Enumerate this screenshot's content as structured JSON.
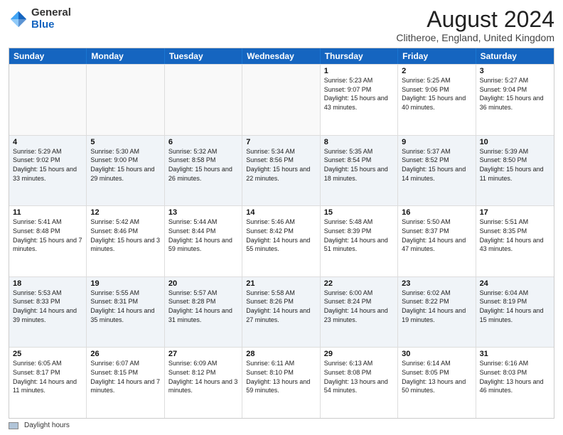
{
  "header": {
    "logo_general": "General",
    "logo_blue": "Blue",
    "main_title": "August 2024",
    "subtitle": "Clitheroe, England, United Kingdom"
  },
  "calendar": {
    "headers": [
      "Sunday",
      "Monday",
      "Tuesday",
      "Wednesday",
      "Thursday",
      "Friday",
      "Saturday"
    ],
    "rows": [
      [
        {
          "day": "",
          "sunrise": "",
          "sunset": "",
          "daylight": "",
          "empty": true
        },
        {
          "day": "",
          "sunrise": "",
          "sunset": "",
          "daylight": "",
          "empty": true
        },
        {
          "day": "",
          "sunrise": "",
          "sunset": "",
          "daylight": "",
          "empty": true
        },
        {
          "day": "",
          "sunrise": "",
          "sunset": "",
          "daylight": "",
          "empty": true
        },
        {
          "day": "1",
          "sunrise": "Sunrise: 5:23 AM",
          "sunset": "Sunset: 9:07 PM",
          "daylight": "Daylight: 15 hours and 43 minutes.",
          "empty": false
        },
        {
          "day": "2",
          "sunrise": "Sunrise: 5:25 AM",
          "sunset": "Sunset: 9:06 PM",
          "daylight": "Daylight: 15 hours and 40 minutes.",
          "empty": false
        },
        {
          "day": "3",
          "sunrise": "Sunrise: 5:27 AM",
          "sunset": "Sunset: 9:04 PM",
          "daylight": "Daylight: 15 hours and 36 minutes.",
          "empty": false
        }
      ],
      [
        {
          "day": "4",
          "sunrise": "Sunrise: 5:29 AM",
          "sunset": "Sunset: 9:02 PM",
          "daylight": "Daylight: 15 hours and 33 minutes.",
          "empty": false
        },
        {
          "day": "5",
          "sunrise": "Sunrise: 5:30 AM",
          "sunset": "Sunset: 9:00 PM",
          "daylight": "Daylight: 15 hours and 29 minutes.",
          "empty": false
        },
        {
          "day": "6",
          "sunrise": "Sunrise: 5:32 AM",
          "sunset": "Sunset: 8:58 PM",
          "daylight": "Daylight: 15 hours and 26 minutes.",
          "empty": false
        },
        {
          "day": "7",
          "sunrise": "Sunrise: 5:34 AM",
          "sunset": "Sunset: 8:56 PM",
          "daylight": "Daylight: 15 hours and 22 minutes.",
          "empty": false
        },
        {
          "day": "8",
          "sunrise": "Sunrise: 5:35 AM",
          "sunset": "Sunset: 8:54 PM",
          "daylight": "Daylight: 15 hours and 18 minutes.",
          "empty": false
        },
        {
          "day": "9",
          "sunrise": "Sunrise: 5:37 AM",
          "sunset": "Sunset: 8:52 PM",
          "daylight": "Daylight: 15 hours and 14 minutes.",
          "empty": false
        },
        {
          "day": "10",
          "sunrise": "Sunrise: 5:39 AM",
          "sunset": "Sunset: 8:50 PM",
          "daylight": "Daylight: 15 hours and 11 minutes.",
          "empty": false
        }
      ],
      [
        {
          "day": "11",
          "sunrise": "Sunrise: 5:41 AM",
          "sunset": "Sunset: 8:48 PM",
          "daylight": "Daylight: 15 hours and 7 minutes.",
          "empty": false
        },
        {
          "day": "12",
          "sunrise": "Sunrise: 5:42 AM",
          "sunset": "Sunset: 8:46 PM",
          "daylight": "Daylight: 15 hours and 3 minutes.",
          "empty": false
        },
        {
          "day": "13",
          "sunrise": "Sunrise: 5:44 AM",
          "sunset": "Sunset: 8:44 PM",
          "daylight": "Daylight: 14 hours and 59 minutes.",
          "empty": false
        },
        {
          "day": "14",
          "sunrise": "Sunrise: 5:46 AM",
          "sunset": "Sunset: 8:42 PM",
          "daylight": "Daylight: 14 hours and 55 minutes.",
          "empty": false
        },
        {
          "day": "15",
          "sunrise": "Sunrise: 5:48 AM",
          "sunset": "Sunset: 8:39 PM",
          "daylight": "Daylight: 14 hours and 51 minutes.",
          "empty": false
        },
        {
          "day": "16",
          "sunrise": "Sunrise: 5:50 AM",
          "sunset": "Sunset: 8:37 PM",
          "daylight": "Daylight: 14 hours and 47 minutes.",
          "empty": false
        },
        {
          "day": "17",
          "sunrise": "Sunrise: 5:51 AM",
          "sunset": "Sunset: 8:35 PM",
          "daylight": "Daylight: 14 hours and 43 minutes.",
          "empty": false
        }
      ],
      [
        {
          "day": "18",
          "sunrise": "Sunrise: 5:53 AM",
          "sunset": "Sunset: 8:33 PM",
          "daylight": "Daylight: 14 hours and 39 minutes.",
          "empty": false
        },
        {
          "day": "19",
          "sunrise": "Sunrise: 5:55 AM",
          "sunset": "Sunset: 8:31 PM",
          "daylight": "Daylight: 14 hours and 35 minutes.",
          "empty": false
        },
        {
          "day": "20",
          "sunrise": "Sunrise: 5:57 AM",
          "sunset": "Sunset: 8:28 PM",
          "daylight": "Daylight: 14 hours and 31 minutes.",
          "empty": false
        },
        {
          "day": "21",
          "sunrise": "Sunrise: 5:58 AM",
          "sunset": "Sunset: 8:26 PM",
          "daylight": "Daylight: 14 hours and 27 minutes.",
          "empty": false
        },
        {
          "day": "22",
          "sunrise": "Sunrise: 6:00 AM",
          "sunset": "Sunset: 8:24 PM",
          "daylight": "Daylight: 14 hours and 23 minutes.",
          "empty": false
        },
        {
          "day": "23",
          "sunrise": "Sunrise: 6:02 AM",
          "sunset": "Sunset: 8:22 PM",
          "daylight": "Daylight: 14 hours and 19 minutes.",
          "empty": false
        },
        {
          "day": "24",
          "sunrise": "Sunrise: 6:04 AM",
          "sunset": "Sunset: 8:19 PM",
          "daylight": "Daylight: 14 hours and 15 minutes.",
          "empty": false
        }
      ],
      [
        {
          "day": "25",
          "sunrise": "Sunrise: 6:05 AM",
          "sunset": "Sunset: 8:17 PM",
          "daylight": "Daylight: 14 hours and 11 minutes.",
          "empty": false
        },
        {
          "day": "26",
          "sunrise": "Sunrise: 6:07 AM",
          "sunset": "Sunset: 8:15 PM",
          "daylight": "Daylight: 14 hours and 7 minutes.",
          "empty": false
        },
        {
          "day": "27",
          "sunrise": "Sunrise: 6:09 AM",
          "sunset": "Sunset: 8:12 PM",
          "daylight": "Daylight: 14 hours and 3 minutes.",
          "empty": false
        },
        {
          "day": "28",
          "sunrise": "Sunrise: 6:11 AM",
          "sunset": "Sunset: 8:10 PM",
          "daylight": "Daylight: 13 hours and 59 minutes.",
          "empty": false
        },
        {
          "day": "29",
          "sunrise": "Sunrise: 6:13 AM",
          "sunset": "Sunset: 8:08 PM",
          "daylight": "Daylight: 13 hours and 54 minutes.",
          "empty": false
        },
        {
          "day": "30",
          "sunrise": "Sunrise: 6:14 AM",
          "sunset": "Sunset: 8:05 PM",
          "daylight": "Daylight: 13 hours and 50 minutes.",
          "empty": false
        },
        {
          "day": "31",
          "sunrise": "Sunrise: 6:16 AM",
          "sunset": "Sunset: 8:03 PM",
          "daylight": "Daylight: 13 hours and 46 minutes.",
          "empty": false
        }
      ]
    ]
  },
  "footer": {
    "legend_label": "Daylight hours"
  }
}
